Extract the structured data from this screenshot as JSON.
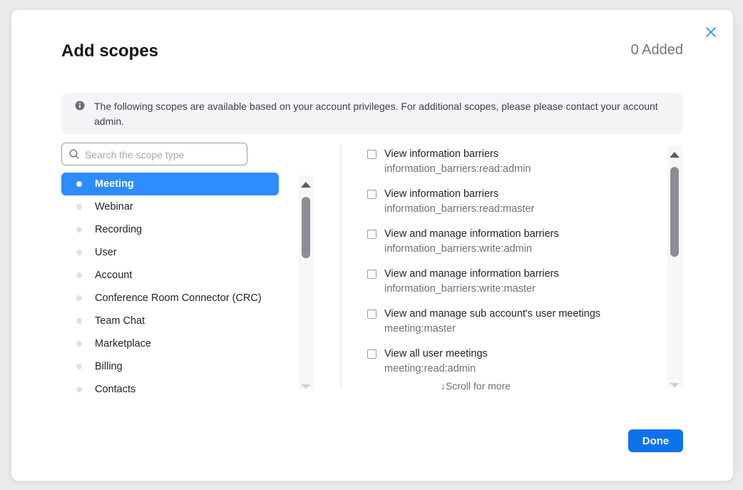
{
  "dialog": {
    "title": "Add scopes",
    "added_count": "0 Added",
    "info_text": "The following scopes are available based on your account privileges. For additional scopes, please please contact your account admin.",
    "done_label": "Done",
    "scroll_hint": "Scroll for more"
  },
  "search": {
    "placeholder": "Search the scope type",
    "value": ""
  },
  "categories": [
    {
      "label": "Meeting",
      "active": true
    },
    {
      "label": "Webinar"
    },
    {
      "label": "Recording"
    },
    {
      "label": "User"
    },
    {
      "label": "Account"
    },
    {
      "label": "Conference Room Connector (CRC)"
    },
    {
      "label": "Team Chat"
    },
    {
      "label": "Marketplace"
    },
    {
      "label": "Billing"
    },
    {
      "label": "Contacts"
    }
  ],
  "scopes": [
    {
      "name": "View information barriers",
      "code": "information_barriers:read:admin"
    },
    {
      "name": "View information barriers",
      "code": "information_barriers:read:master"
    },
    {
      "name": "View and manage information barriers",
      "code": "information_barriers:write:admin"
    },
    {
      "name": "View and manage information barriers",
      "code": "information_barriers:write:master"
    },
    {
      "name": "View and manage sub account's user meetings",
      "code": "meeting:master"
    },
    {
      "name": "View all user meetings",
      "code": "meeting:read:admin"
    }
  ],
  "colors": {
    "accent": "#2d8cff",
    "button": "#0e72ed"
  },
  "icons": {
    "close": "close-icon",
    "info": "info-icon",
    "search": "search-icon",
    "arrow": "arrow-down-icon"
  }
}
